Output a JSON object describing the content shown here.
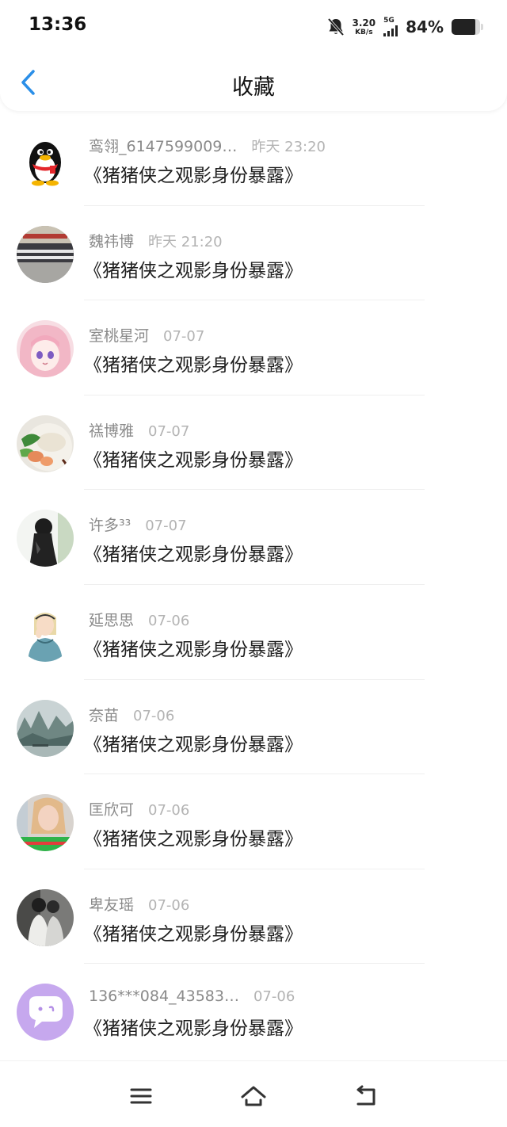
{
  "status_bar": {
    "time": "13:36",
    "net_speed_value": "3.20",
    "net_speed_unit": "KB/s",
    "network_type": "5G",
    "battery_percent": "84%",
    "battery_level": 0.84,
    "icons": [
      "bell-muted-icon",
      "signal-icon",
      "battery-icon"
    ]
  },
  "header": {
    "back_icon": "chevron-left-icon",
    "title": "收藏",
    "accent_color": "#2b8fe8"
  },
  "favorites": [
    {
      "name": "鸾翎_6147599009…",
      "time": "昨天 23:20",
      "title": "《猪猪侠之观影身份暴露》",
      "avatar": "qq-penguin"
    },
    {
      "name": "魏祎博",
      "time": "昨天 21:20",
      "title": "《猪猪侠之观影身份暴露》",
      "avatar": "group-photo"
    },
    {
      "name": "室桃星河",
      "time": "07-07",
      "title": "《猪猪侠之观影身份暴露》",
      "avatar": "anime-girl-pink"
    },
    {
      "name": "禚博雅",
      "time": "07-07",
      "title": "《猪猪侠之观影身份暴露》",
      "avatar": "food-dish"
    },
    {
      "name": "许多³³",
      "time": "07-07",
      "title": "《猪猪侠之观影身份暴露》",
      "avatar": "silhouette"
    },
    {
      "name": "延思思",
      "time": "07-06",
      "title": "《猪猪侠之观影身份暴露》",
      "avatar": "cartoon-girl"
    },
    {
      "name": "奈苗",
      "time": "07-06",
      "title": "《猪猪侠之观影身份暴露》",
      "avatar": "landscape"
    },
    {
      "name": "匡欣可",
      "time": "07-06",
      "title": "《猪猪侠之观影身份暴露》",
      "avatar": "selfie"
    },
    {
      "name": "卑友瑶",
      "time": "07-06",
      "title": "《猪猪侠之观影身份暴露》",
      "avatar": "couple"
    },
    {
      "name": "136***084_43583…",
      "time": "07-06",
      "title": "《猪猪侠之观影身份暴露》",
      "avatar": "default-chat-bubble"
    }
  ],
  "nav_bar": {
    "icons": [
      "menu-icon",
      "home-icon",
      "back-icon"
    ]
  }
}
